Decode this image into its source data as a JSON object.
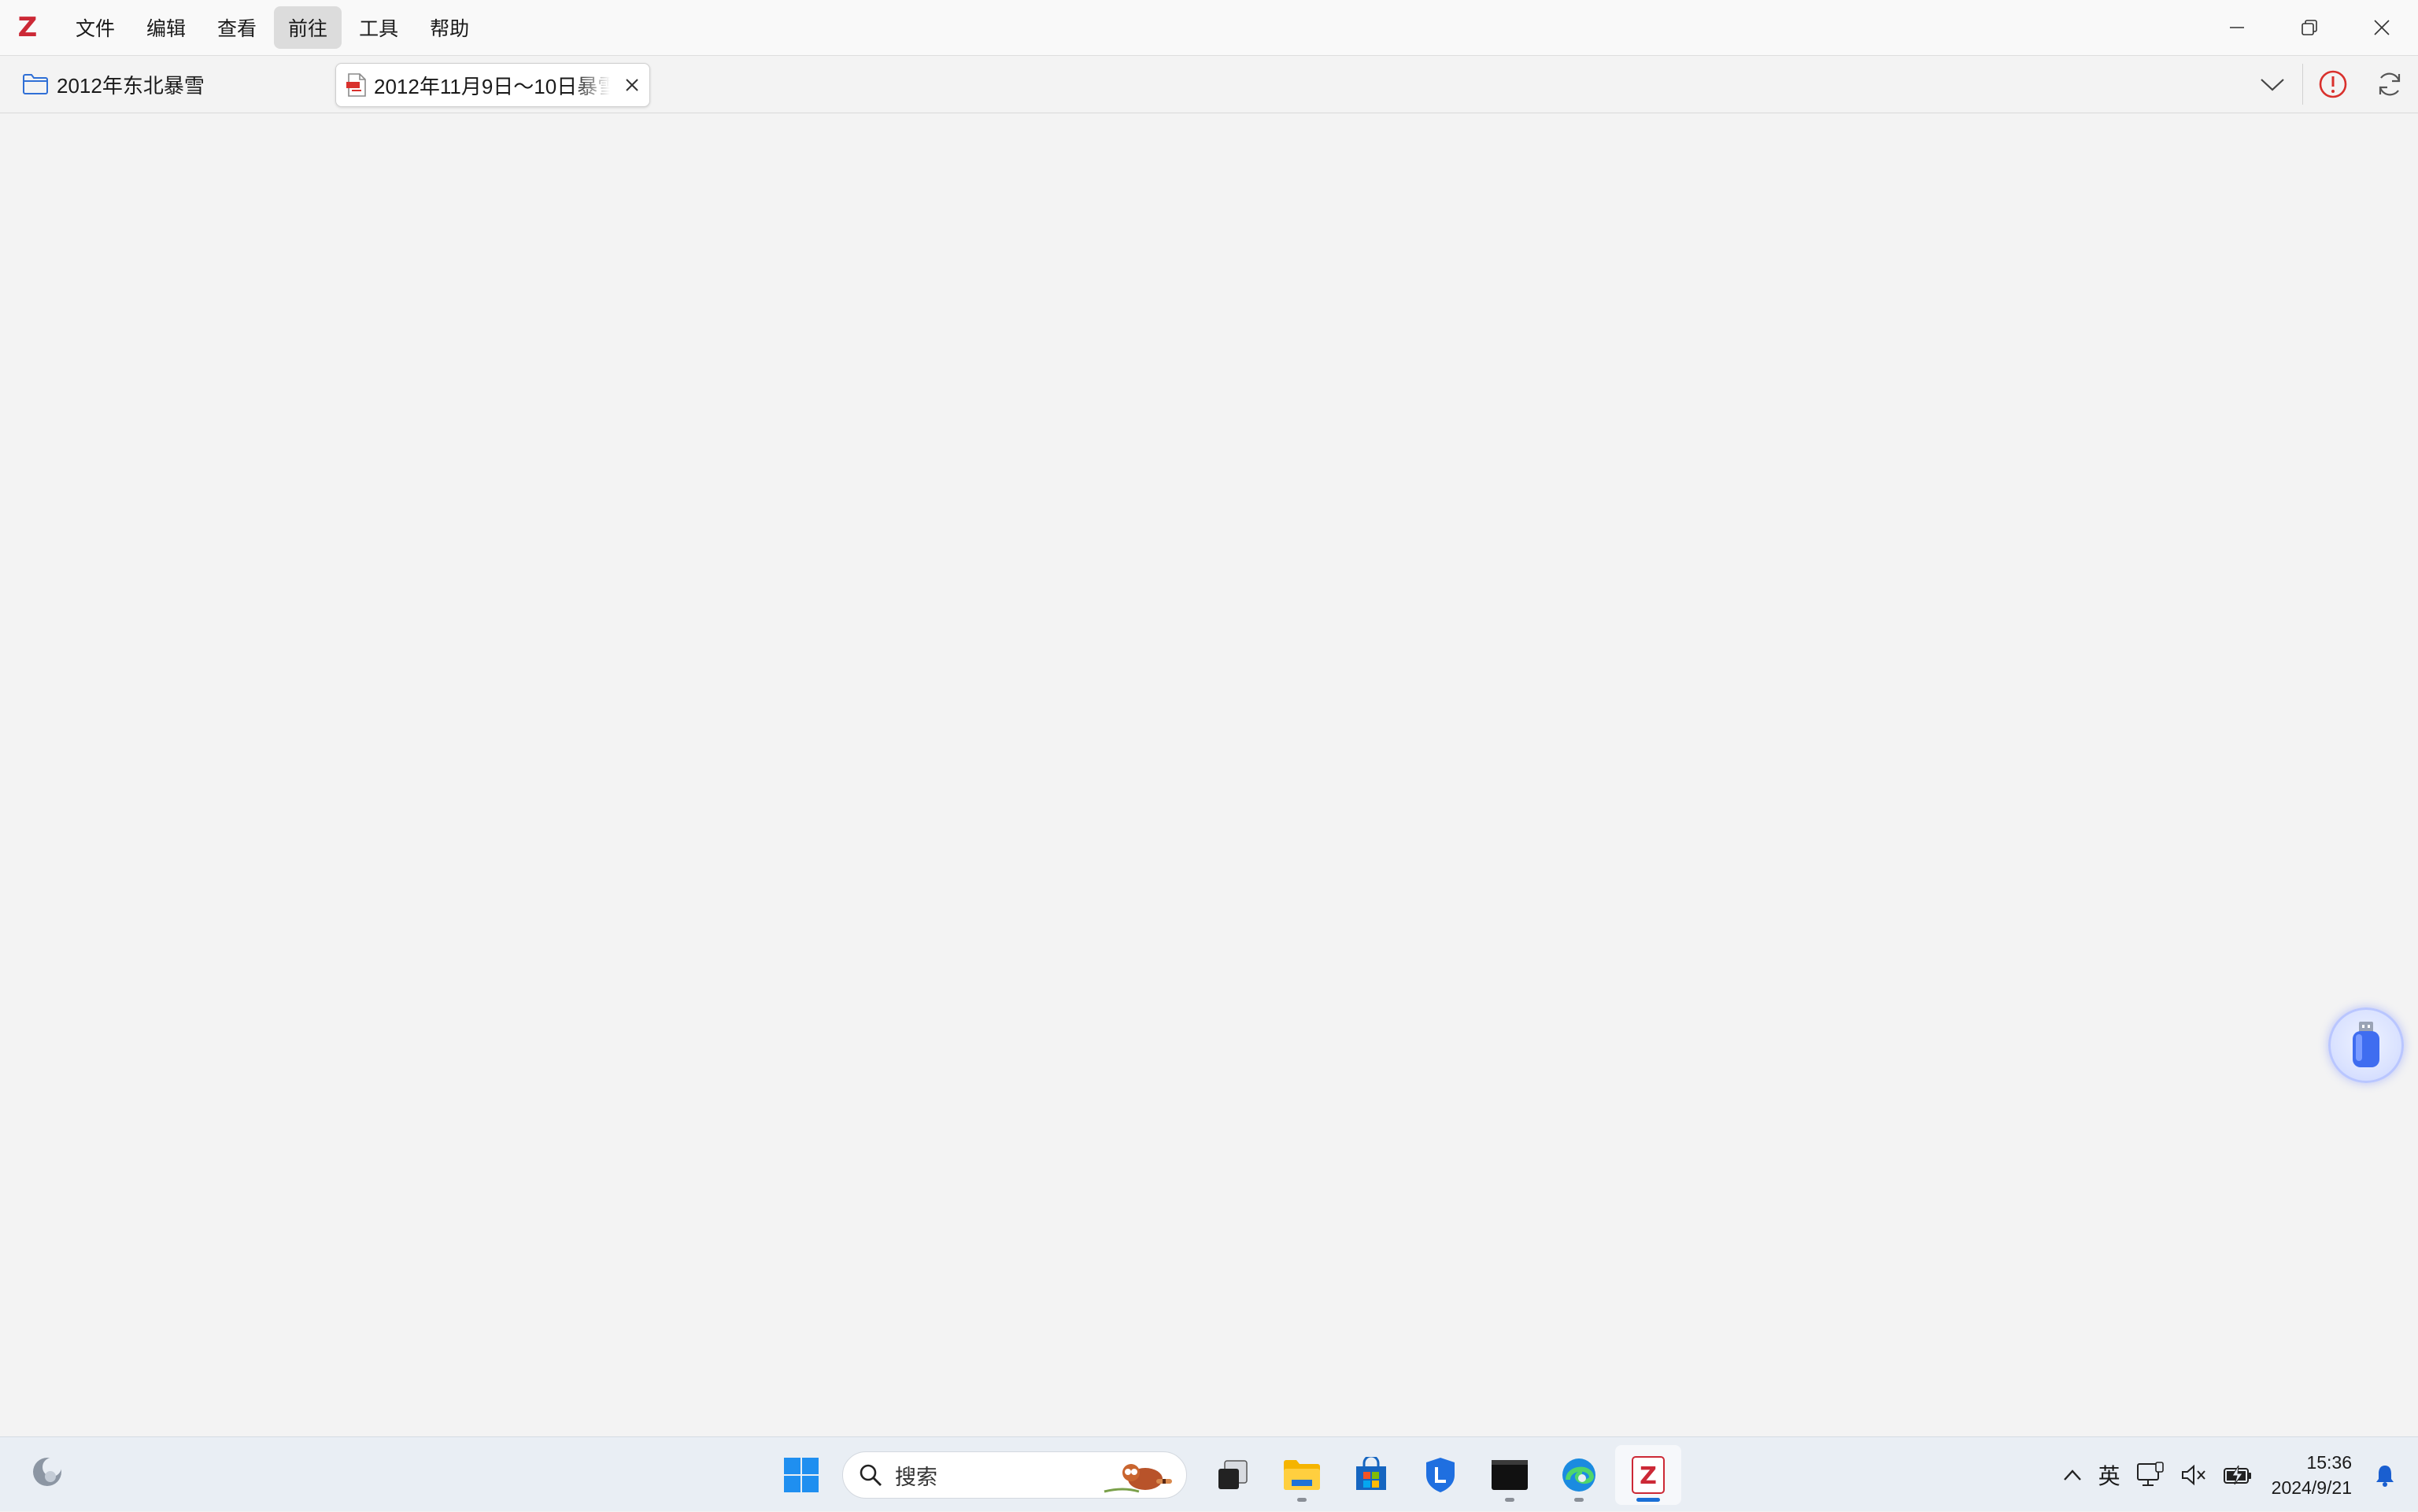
{
  "app": {
    "logo_letter": "Z",
    "brand_color": "#cc2936"
  },
  "menu": {
    "items": [
      {
        "label": "文件",
        "active": false
      },
      {
        "label": "编辑",
        "active": false
      },
      {
        "label": "查看",
        "active": false
      },
      {
        "label": "前往",
        "active": true
      },
      {
        "label": "工具",
        "active": false
      },
      {
        "label": "帮助",
        "active": false
      }
    ]
  },
  "window_controls": {
    "minimize_icon": "minimize-icon",
    "restore_icon": "restore-icon",
    "close_icon": "close-icon"
  },
  "tabs": {
    "library_tab": {
      "label": "2012年东北暴雪",
      "icon": "folder-icon"
    },
    "document_tab": {
      "label": "2012年11月9日～10日暴雪",
      "icon": "pdf-icon",
      "close_icon": "close-icon"
    },
    "right_buttons": {
      "dropdown_icon": "chevron-down-icon",
      "error_icon": "sync-error-icon",
      "sync_icon": "sync-icon"
    }
  },
  "taskbar": {
    "search": {
      "label": "搜索"
    },
    "apps": [
      {
        "name": "start-menu",
        "running": false
      },
      {
        "name": "task-view",
        "running": false
      },
      {
        "name": "file-explorer",
        "running": true
      },
      {
        "name": "microsoft-store",
        "running": false
      },
      {
        "name": "lenovo-app",
        "running": false
      },
      {
        "name": "terminal",
        "running": true
      },
      {
        "name": "edge-browser",
        "running": true
      },
      {
        "name": "zotero",
        "running": true,
        "active": true
      }
    ],
    "tray": {
      "ime_label": "英",
      "time": "15:36",
      "date": "2024/9/21"
    }
  }
}
